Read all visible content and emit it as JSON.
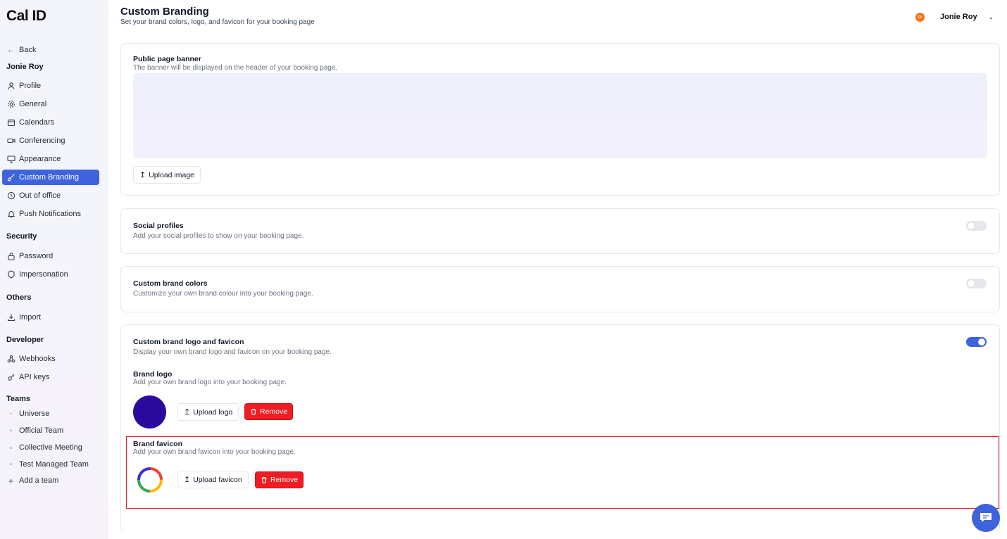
{
  "app": {
    "logo": "Cal ID"
  },
  "header": {
    "title": "Custom Branding",
    "subtitle": "Set your brand colors, logo, and favicon for your booking page"
  },
  "user": {
    "initial": "G",
    "name": "Jonie Roy",
    "avatar_color": "#f97316"
  },
  "sidebar": {
    "back": "Back",
    "account_name": "Jonie Roy",
    "items": [
      {
        "label": "Profile",
        "icon": "user-icon"
      },
      {
        "label": "General",
        "icon": "gear-icon"
      },
      {
        "label": "Calendars",
        "icon": "calendar-icon"
      },
      {
        "label": "Conferencing",
        "icon": "video-icon"
      },
      {
        "label": "Appearance",
        "icon": "monitor-icon"
      },
      {
        "label": "Custom Branding",
        "icon": "brush-icon",
        "active": true
      },
      {
        "label": "Out of office",
        "icon": "clock-icon"
      },
      {
        "label": "Push Notifications",
        "icon": "bell-icon"
      }
    ],
    "security_label": "Security",
    "security_items": [
      {
        "label": "Password",
        "icon": "lock-icon"
      },
      {
        "label": "Impersonation",
        "icon": "shield-icon"
      }
    ],
    "others_label": "Others",
    "others_items": [
      {
        "label": "Import",
        "icon": "download-icon"
      }
    ],
    "developer_label": "Developer",
    "developer_items": [
      {
        "label": "Webhooks",
        "icon": "webhook-icon"
      },
      {
        "label": "API keys",
        "icon": "key-icon"
      }
    ],
    "teams_label": "Teams",
    "teams_items": [
      {
        "label": "Universe",
        "icon": "team-logo-icon"
      },
      {
        "label": "Official Team",
        "icon": "team-logo-icon"
      },
      {
        "label": "Collective Meeting",
        "icon": "team-logo-icon"
      },
      {
        "label": "Test Managed Team",
        "icon": "team-logo-icon"
      },
      {
        "label": "Add a team",
        "icon": "plus-icon"
      }
    ]
  },
  "banner": {
    "title": "Public page banner",
    "desc": "The banner will be displayed on the header of your booking page.",
    "upload_label": "Upload image"
  },
  "social": {
    "title": "Social profiles",
    "desc": "Add your social profiles to show on your booking page.",
    "enabled": false
  },
  "colors": {
    "title": "Custom brand colors",
    "desc": "Customize your own brand colour into your booking page.",
    "enabled": false
  },
  "logo_favicon": {
    "title": "Custom brand logo and favicon",
    "desc": "Display your own brand logo and favicon on your booking page.",
    "enabled": true,
    "brand_logo_title": "Brand logo",
    "brand_logo_desc": "Add your own brand logo into your booking page.",
    "upload_logo_label": "Upload logo",
    "remove_label": "Remove",
    "logo_color": "#2b0a9e",
    "brand_favicon_title": "Brand favicon",
    "brand_favicon_desc": "Add your own brand favicon into your booking page.",
    "upload_favicon_label": "Upload favicon"
  },
  "colors_palette": {
    "accent": "#3e63dd",
    "danger": "#ef1c23"
  }
}
